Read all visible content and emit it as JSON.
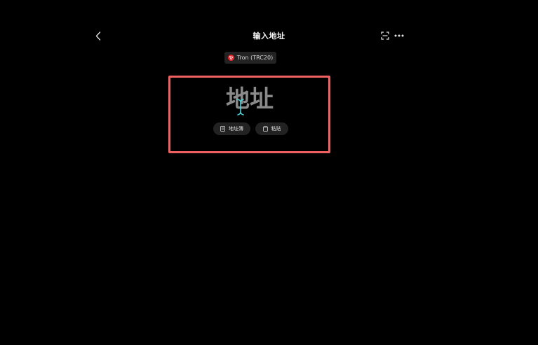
{
  "header": {
    "title": "输入地址",
    "back_icon": "chevron-left-icon",
    "scan_icon": "scan-icon",
    "more_icon": "more-horizontal-icon"
  },
  "network": {
    "label": "Tron (TRC20)",
    "icon": "tron-icon",
    "icon_color": "#e8282b"
  },
  "address_input": {
    "placeholder": "地址",
    "value": ""
  },
  "actions": {
    "address_book_label": "地址簿",
    "address_book_icon": "address-book-icon",
    "paste_label": "粘贴",
    "paste_icon": "clipboard-icon"
  },
  "colors": {
    "background": "#000000",
    "highlight": "#ef6061",
    "cursor": "#4fd1d9",
    "pill_background": "#222222"
  }
}
